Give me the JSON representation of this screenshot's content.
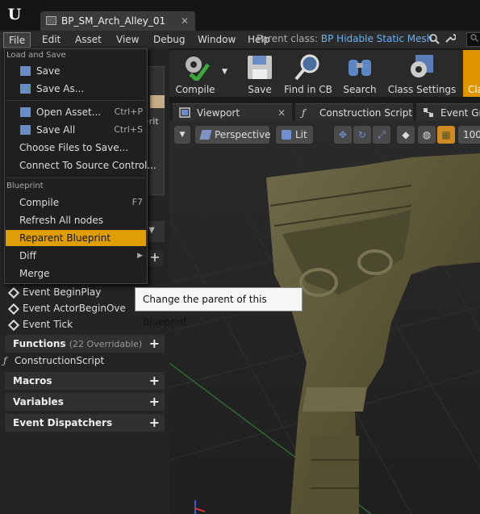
{
  "titlebar": {
    "logo": "U",
    "tab_label": "BP_SM_Arch_Alley_01",
    "tab_close": "✕"
  },
  "menubar": {
    "items": [
      "File",
      "Edit",
      "Asset",
      "View",
      "Debug",
      "Window",
      "Help"
    ]
  },
  "parent_class": {
    "label": "Parent class:",
    "value": "BP Hidable Static Mesh"
  },
  "toolbar": {
    "compile": "Compile",
    "save": "Save",
    "find_in_cb": "Find in CB",
    "search": "Search",
    "class_settings": "Class Settings",
    "class_defaults": "Cla"
  },
  "tabs": {
    "viewport": "Viewport",
    "construction_script": "Construction Script",
    "event_graph": "Event Gra"
  },
  "viewport_toolbar": {
    "perspective": "Perspective",
    "lit": "Lit",
    "grid_value": "100"
  },
  "details": {
    "inherit_label": "erit"
  },
  "file_menu": {
    "section_load_save": "Load and Save",
    "save": "Save",
    "save_as": "Save As...",
    "open_asset": "Open Asset...",
    "open_asset_shortcut": "Ctrl+P",
    "save_all": "Save All",
    "save_all_shortcut": "Ctrl+S",
    "choose_files": "Choose Files to Save...",
    "connect_source": "Connect To Source Control...",
    "section_blueprint": "Blueprint",
    "compile": "Compile",
    "compile_shortcut": "F7",
    "refresh_nodes": "Refresh All nodes",
    "reparent": "Reparent Blueprint",
    "diff": "Diff",
    "merge": "Merge"
  },
  "tooltip": "Change the parent of this Blueprint",
  "my_blueprint": {
    "events": [
      "Event BeginPlay",
      "Event ActorBeginOve",
      "Event Tick"
    ],
    "functions_label": "Functions",
    "functions_sub": "(22 Overridable)",
    "construction_script": "ConstructionScript",
    "macros_label": "Macros",
    "variables_label": "Variables",
    "dispatchers_label": "Event Dispatchers"
  },
  "colors": {
    "accent": "#e09e05",
    "link": "#6ab0f0",
    "classic_button": "#e09400"
  }
}
